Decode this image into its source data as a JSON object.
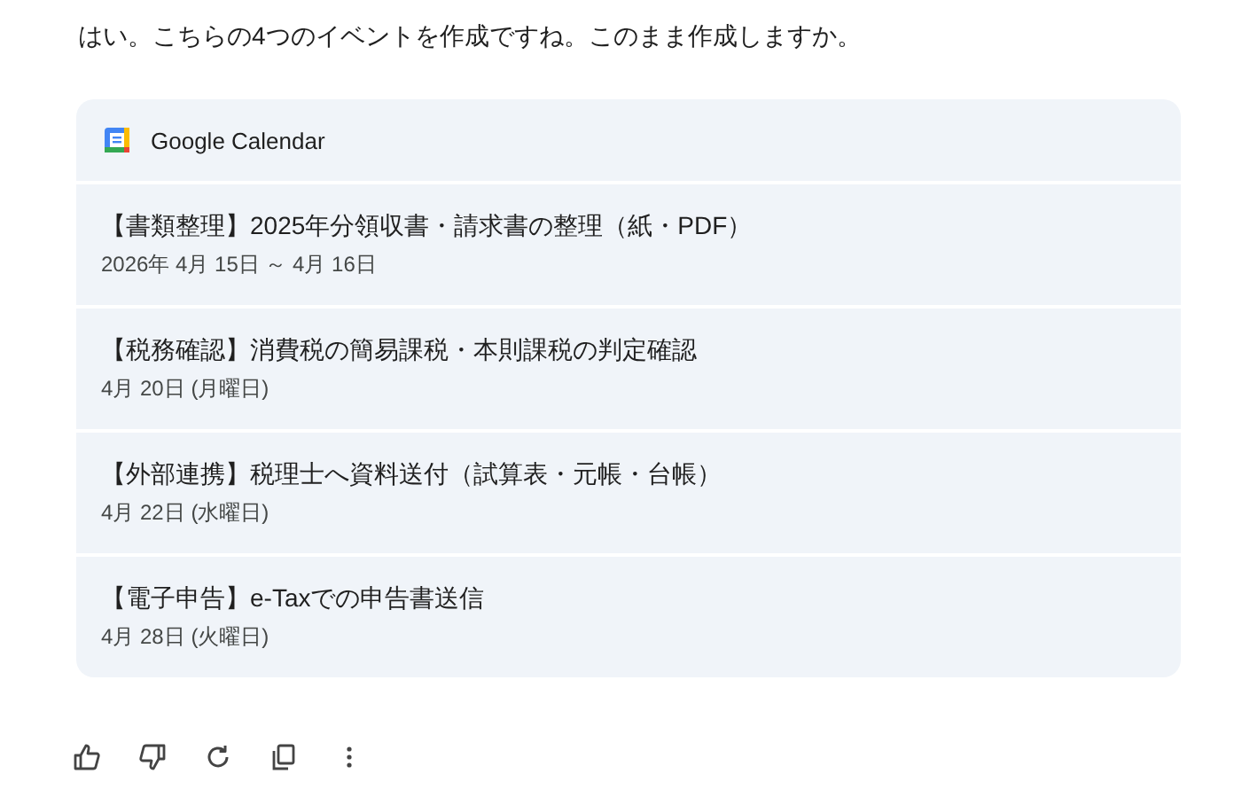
{
  "message": "はい。こちらの4つのイベントを作成ですね。このまま作成しますか。",
  "card": {
    "title": "Google Calendar",
    "events": [
      {
        "title": "【書類整理】2025年分領収書・請求書の整理（紙・PDF）",
        "date": "2026年 4月 15日 ～ 4月 16日"
      },
      {
        "title": "【税務確認】消費税の簡易課税・本則課税の判定確認",
        "date": "4月 20日 (月曜日)"
      },
      {
        "title": "【外部連携】税理士へ資料送付（試算表・元帳・台帳）",
        "date": "4月 22日 (水曜日)"
      },
      {
        "title": "【電子申告】e-Taxでの申告書送信",
        "date": "4月 28日 (火曜日)"
      }
    ]
  }
}
